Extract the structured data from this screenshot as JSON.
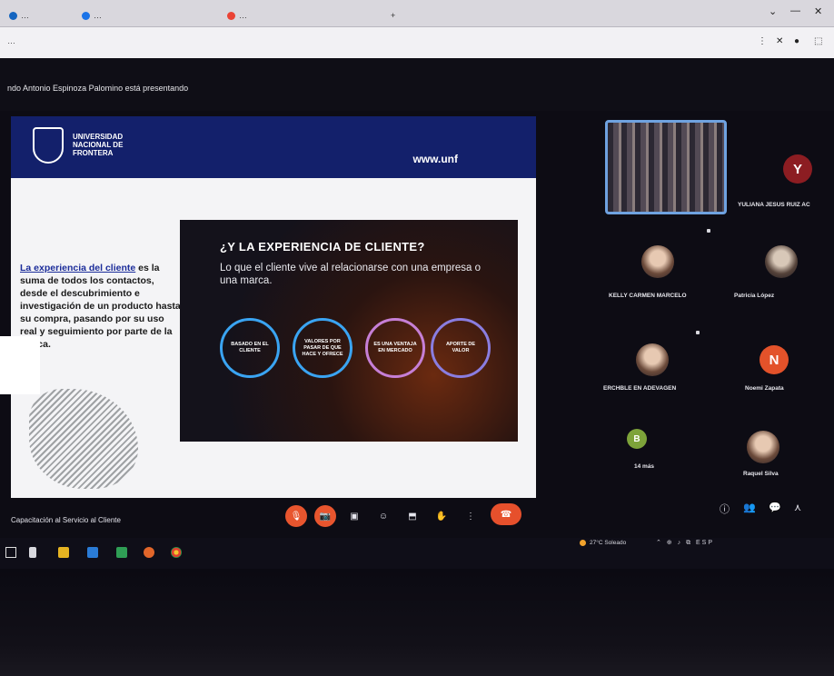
{
  "browser": {
    "tabs": [
      {
        "label": "…",
        "fav": "#1565c0"
      },
      {
        "label": "…",
        "fav": "#1a73e8"
      },
      {
        "label": "…",
        "fav": "#ea4335"
      }
    ],
    "new_tab": "+",
    "url": "…",
    "window_controls": [
      "⌄",
      "—",
      "✕"
    ],
    "toolbar_icons": [
      "⋮",
      "✕",
      "●",
      "⬚"
    ]
  },
  "meet": {
    "presenting_text": "ndo Antonio Espinoza Palomino está presentando",
    "meeting_title": "Capacitación al Servicio al Cliente"
  },
  "slide": {
    "logo_lines": [
      "UNIVERSIDAD",
      "NACIONAL DE",
      "FRONTERA"
    ],
    "site": "www.unf",
    "left_text_highlight": "La experiencia del cliente",
    "left_text_rest": " es la suma de todos los contactos, desde el descubrimiento e investigación de un producto hasta su compra, pasando por su uso real y seguimiento por parte de la marca.",
    "inner_title": "¿Y LA EXPERIENCIA DE CLIENTE?",
    "inner_subtitle": "Lo que el cliente vive al relacionarse con una empresa o una marca.",
    "circles": [
      {
        "label": "BASADO EN EL CLIENTE",
        "color": "#3aa4f2"
      },
      {
        "label": "VALORES POR PASAR DE QUE HACE Y OFRECE",
        "color": "#3aa4f2"
      },
      {
        "label": "ES UNA VENTAJA EN MERCADO",
        "color": "#c67fd6"
      },
      {
        "label": "APORTE DE VALOR",
        "color": "#8a7de0"
      }
    ]
  },
  "participants": [
    {
      "name": "",
      "type": "self"
    },
    {
      "name": "YULIANA JESUS RUIZ AC",
      "initial": "Y",
      "color": "#8c1d22"
    },
    {
      "name": "KELLY CARMEN MARCELO",
      "type": "photo"
    },
    {
      "name": "Patricia López",
      "type": "photo"
    },
    {
      "name": "ERCHBLE EN ADEVAGEN",
      "type": "photo"
    },
    {
      "name": "Noemi Zapata",
      "initial": "N",
      "color": "#e3522a"
    },
    {
      "name": "14 más",
      "type": "more"
    },
    {
      "name": "Raquel Silva",
      "type": "photo"
    }
  ],
  "controls": {
    "mic": "🎙",
    "camera": "📷",
    "captions": "▣",
    "emoji": "☺",
    "present": "⬒",
    "hand": "✋",
    "more": "⋮",
    "end": "☎",
    "info": "ⓘ",
    "people": "👥",
    "chat": "💬",
    "activities": "⋏"
  },
  "taskbar": {
    "weather": "27°C Soleado",
    "tray": "⌃ ⊕ ♪ ⧉ ESP"
  }
}
